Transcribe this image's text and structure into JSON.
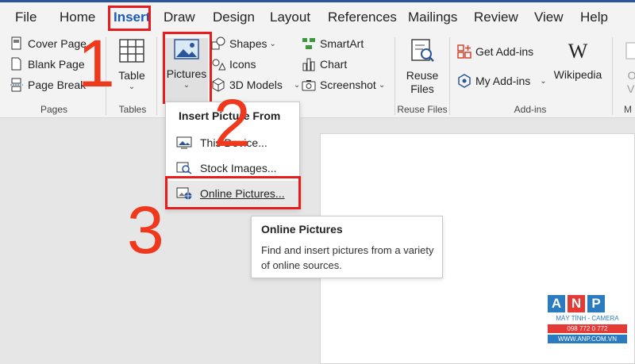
{
  "tabs": [
    {
      "label": "File"
    },
    {
      "label": "Home"
    },
    {
      "label": "Insert",
      "active": true
    },
    {
      "label": "Draw"
    },
    {
      "label": "Design"
    },
    {
      "label": "Layout"
    },
    {
      "label": "References"
    },
    {
      "label": "Mailings"
    },
    {
      "label": "Review"
    },
    {
      "label": "View"
    },
    {
      "label": "Help"
    }
  ],
  "ribbon": {
    "pages": {
      "items": [
        "Cover Page",
        "Blank Page",
        "Page Break"
      ],
      "group_label": "Pages"
    },
    "tables": {
      "button_label": "Table",
      "group_label": "Tables"
    },
    "illustrations": {
      "pictures_label": "Pictures",
      "shapes_label": "Shapes",
      "icons_label": "Icons",
      "models_label": "3D Models",
      "smartart_label": "SmartArt",
      "chart_label": "Chart",
      "screenshot_label": "Screenshot"
    },
    "reuse": {
      "button_label_1": "Reuse",
      "button_label_2": "Files",
      "group_label": "Reuse Files"
    },
    "addins": {
      "get_label": "Get Add-ins",
      "my_label": "My Add-ins",
      "wikipedia_label": "Wikipedia",
      "wikipedia_glyph": "W",
      "group_label": "Add-ins"
    },
    "media": {
      "label_1": "On",
      "label_2": "Vid",
      "group_label": "M"
    }
  },
  "insert_picture_menu": {
    "title": "Insert Picture From",
    "items": [
      "This Device...",
      "Stock Images...",
      "Online Pictures..."
    ]
  },
  "tooltip": {
    "title": "Online Pictures",
    "body": "Find and insert pictures from a variety of online sources."
  },
  "step_numbers": [
    "1",
    "2",
    "3"
  ],
  "watermark": {
    "letters": [
      "A",
      "N",
      "P"
    ],
    "line1": "MÁY TÍNH - CAMERA",
    "line2": "098 772 0 772",
    "line3": "WWW.ANP.COM.VN"
  },
  "colors": {
    "accent": "#185abd",
    "highlight_red": "#e81c1c",
    "step_number": "#f0381c",
    "watermark_blue": "#2b7bc0",
    "watermark_red": "#e53935"
  }
}
